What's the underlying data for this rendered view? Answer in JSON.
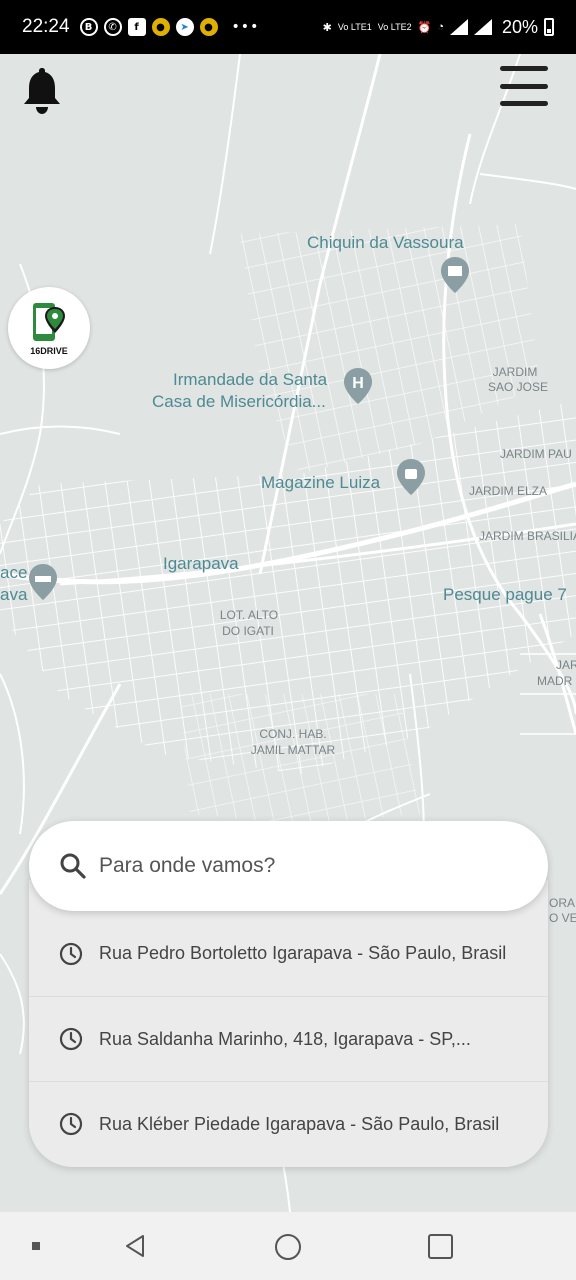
{
  "status_bar": {
    "time": "22:24",
    "battery": "20%",
    "left_icons": [
      "B",
      "whatsapp-icon",
      "f",
      "•",
      "telegram-icon",
      "•"
    ],
    "vo1": "Vo LTE1",
    "vo2": "Vo LTE2"
  },
  "map": {
    "labels": {
      "chiquin": "Chiquin da Vassoura",
      "irmandade_1": "Irmandade da Santa",
      "irmandade_2": "Casa de Misericórdia...",
      "magazine": "Magazine Luiza",
      "igarapava": "Igarapava",
      "pesque": "Pesque pague 7",
      "ace": "ace",
      "ava": "ava",
      "jardim_sao_jose_1": "JARDIM",
      "jardim_sao_jose_2": "SAO JOSE",
      "jardim_pau": "JARDIM PAU",
      "jardim_elza": "JARDIM ELZA",
      "jardim_brasilia": "JARDIM BRASILIA",
      "lot_alto_1": "LOT. ALTO",
      "lot_alto_2": "DO IGATI",
      "conj_hab_1": "CONJ. HAB.",
      "conj_hab_2": "JAMIL MATTAR",
      "jar_madr_1": "JAR",
      "jar_madr_2": "MADR",
      "ora_1": "ORA",
      "ora_2": "O VER"
    }
  },
  "logo": {
    "text": "16DRIVE"
  },
  "search": {
    "placeholder": "Para onde vamos?"
  },
  "recent_places": [
    "Rua Pedro Bortoletto Igarapava - São Paulo, Brasil",
    "Rua Saldanha Marinho, 418, Igarapava - SP,...",
    "Rua Kléber Piedade Igarapava - São Paulo, Brasil"
  ],
  "colors": {
    "map_background": "#e0e4e3",
    "road": "#ffffff",
    "label_teal": "#4e8a93",
    "logo_green": "#2e8b3e"
  }
}
